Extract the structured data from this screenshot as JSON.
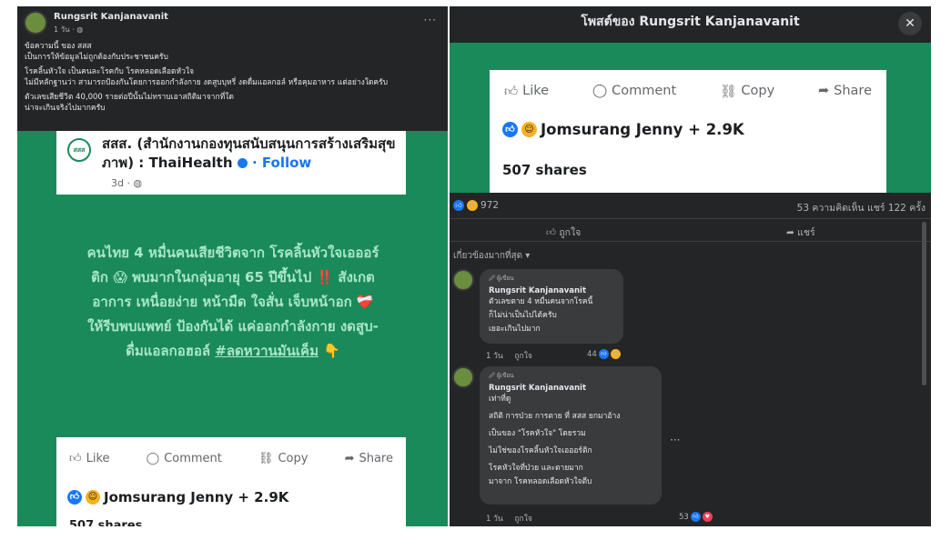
{
  "left_post": {
    "author": "Rungsrit Kanjanavanit",
    "time": "1 วัน · ",
    "more": "···",
    "body": [
      "ข้อความนี้ ของ สสส",
      "เป็นการให้ข้อมูลไม่ถูกต้องกับประชาชนครับ",
      "โรคลิ้นหัวใจ เป็นคนละโรคกับ โรคหลอดเลือดหัวใจ",
      "ไม่มีหลักฐานว่า สามารถป้องกันโดยการออกกำลังกาย งดสูบบุหรี่ งดดื่มแอลกอล์ หรือคุมอาหาร แต่อย่างใดครับ",
      "ตัวเลขเสียชีวิต 40,000 รายต่อปีนั้นไม่ทราบเอาสถิติมาจากที่ใด",
      "น่าจะเกินจริงไปมากครับ"
    ],
    "shared_card": {
      "logo": "สสส",
      "org_name": "สสส. (สำนักงานกองทุนสนับสนุนการสร้างเสริมสุขภาพ) : ThaiHealth",
      "follow": "· Follow",
      "date": "3d · "
    },
    "main_text_a": "คนไทย 4 หมื่นคนเสียชีวิตจาก โรคลิ้นหัวใจเอออร์ติก 😱 พบมากในกลุ่มอายุ 65 ปีขึ้นไป ‼️ สังเกตอาการ เหนื่อยง่าย หน้ามืด ใจสั่น เจ็บหน้าอก ❤️‍🩹 ให้รีบพบแพทย์ ป้องกันได้ แค่ออกกำลังกาย งดสูบ-ดื่มแอลกอฮอล์ ",
    "main_text_tag": "#ลดหวานมันเค็ม",
    "main_text_end": " 👇",
    "actions": {
      "like": "Like",
      "comment": "Comment",
      "copy": "Copy",
      "share": "Share"
    },
    "reactions": "Jomsurang Jenny + 2.9K",
    "shares_partial": "507 shares"
  },
  "right_post": {
    "title": "โพสต์ของ Rungsrit Kanjanavanit",
    "close": "✕",
    "actions": {
      "like": "Like",
      "comment": "Comment",
      "copy": "Copy",
      "share": "Share"
    },
    "reactions": "Jomsurang Jenny + 2.9K",
    "shares": "507 shares",
    "stats_count": "972",
    "stats_right": "53 ความคิดเห็น  แชร์ 122 ครั้ง",
    "like_action": "ถูกใจ",
    "share_action": "แชร์",
    "sort_label": "เกี่ยวข้องมากที่สุด ▾",
    "comments": [
      {
        "badge": "🖉 ผู้เขียน",
        "name": "Rungsrit Kanjanavanit",
        "lines": [
          "ตัวเลขตาย 4 หมื่นคนจากโรคนี้",
          "ก็ไม่น่าเป็นไปได้ครับ",
          "เยอะเกินไปมาก"
        ],
        "time": "1 วัน",
        "like": "ถูกใจ",
        "count": "44"
      },
      {
        "badge": "🖉 ผู้เขียน",
        "name": "Rungsrit Kanjanavanit",
        "lines": [
          "เท่าที่ดู",
          "สถิติ การป่วย การตาย ที่ สสส ยกมาอ้าง",
          "เป็นของ \"โรคหัวใจ\" โดยรวม",
          "ไม่ใช่ของโรคลิ้นหัวใจเอออร์ติก",
          "โรคหัวใจที่ป่วย และตายมาก",
          "มาจาก โรคหลอดเลือดหัวใจตีบ"
        ],
        "time": "1 วัน",
        "like": "ถูกใจ",
        "count": "53",
        "more": "···"
      }
    ]
  }
}
